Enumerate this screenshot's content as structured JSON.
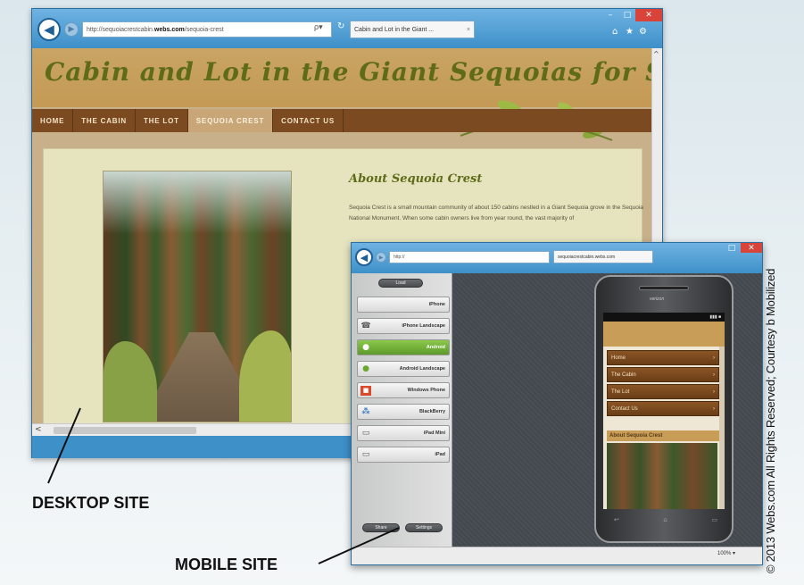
{
  "desktop": {
    "address": {
      "prefix": "http://sequoiacrestcabin.",
      "domain": "webs.com",
      "suffix": "/sequoia-crest"
    },
    "search_symbol": "ρ▾",
    "refresh_icon": "refresh-icon",
    "tab_label": "Cabin and Lot in the Giant ...",
    "window": {
      "min": "–",
      "max": "□",
      "close": "✕"
    },
    "toolbar_icons": [
      "home-icon",
      "star-icon",
      "gear-icon"
    ],
    "site_title": "Cabin and Lot in the Giant Sequoias for Sale!",
    "nav": [
      "HOME",
      "THE CABIN",
      "THE LOT",
      "SEQUOIA CREST",
      "CONTACT US"
    ],
    "nav_active": "SEQUOIA CREST",
    "about_heading": "About Sequoia Crest",
    "about_text": "Sequoia Crest is a small mountain community of about 150 cabins nestled in a Giant Sequoia grove in the Sequoia National Monument. When some cabin owners live from year round, the vast majority of",
    "scroll_up": "^",
    "scroll_left": "<"
  },
  "mobile": {
    "address_prefix": "http://",
    "tab_label": "sequoiacrestcabin.webs.com",
    "top_pill": "Load",
    "device_list": [
      {
        "label": "iPhone",
        "icon": "apple-icon"
      },
      {
        "label": "iPhone Landscape",
        "icon": "phone-icon"
      },
      {
        "label": "Android",
        "icon": "android-icon",
        "active": true
      },
      {
        "label": "Android Landscape",
        "icon": "android-icon"
      },
      {
        "label": "Windows Phone",
        "icon": "windows-icon"
      },
      {
        "label": "BlackBerry",
        "icon": "blackberry-icon"
      },
      {
        "label": "iPad Mini",
        "icon": "tablet-icon"
      },
      {
        "label": "iPad",
        "icon": "tablet-icon"
      }
    ],
    "bottom_pills": [
      "Share",
      "Settings"
    ],
    "phone": {
      "carrier": "verizon",
      "menu": [
        "Home",
        "The Cabin",
        "The Lot",
        "Contact Us"
      ],
      "about": "About Sequoia Crest",
      "nav_icons": [
        "back-icon",
        "home-icon",
        "recent-apps-icon"
      ]
    },
    "zoom": "100% ▾"
  },
  "labels": {
    "desktop": "DESKTOP SITE",
    "mobile": "MOBILE SITE",
    "copyright": "© 2013 Webs.com All Rights Reserved; Courtesy b Mobilized"
  },
  "colors": {
    "browser_frame": "#3c8dc8",
    "site_title": "#5e6b18",
    "nav_bg": "#7b4a20",
    "android_active": "#6aa832"
  }
}
